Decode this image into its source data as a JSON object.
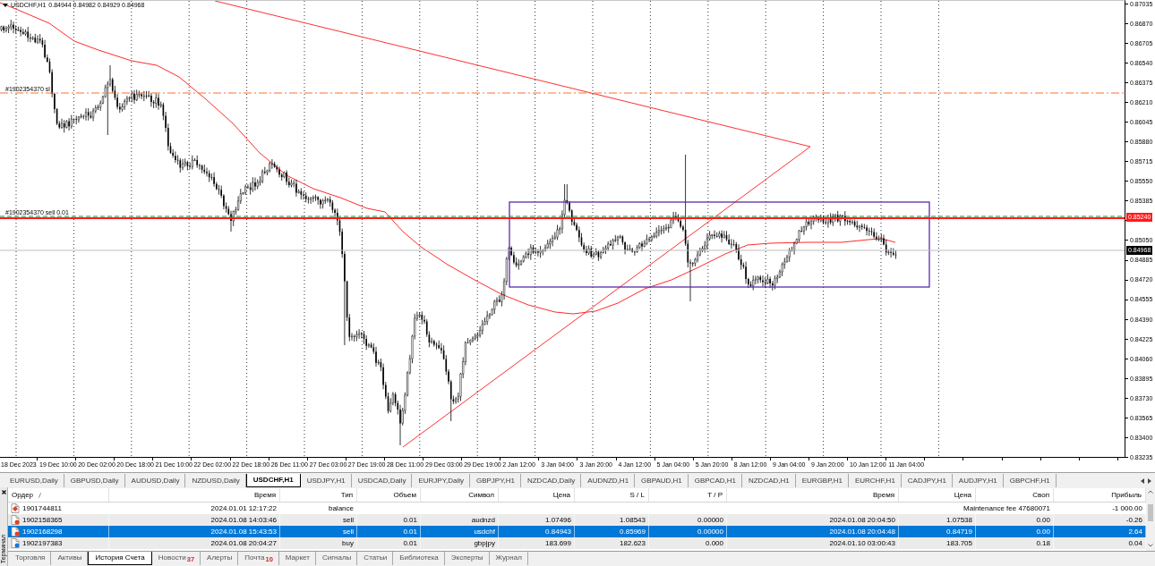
{
  "chart": {
    "symbol": "USDCHF,H1",
    "quotes": "0.84944 0.84982 0.84929 0.84968",
    "order_lines": [
      {
        "kind": "stop_loss",
        "label": "#1902354370 sl"
      },
      {
        "kind": "entry",
        "label": "#1902354370 sell 0.01"
      }
    ],
    "price_tags": [
      {
        "kind": "line",
        "label": "0.85240"
      },
      {
        "kind": "bid",
        "label": "0.84968"
      }
    ],
    "price_axis": [
      "0.87035",
      "0.86870",
      "0.86705",
      "0.86540",
      "0.86375",
      "0.86210",
      "0.86045",
      "0.85880",
      "0.85715",
      "0.85550",
      "0.85385",
      "0.85050",
      "0.84885",
      "0.84720",
      "0.84555",
      "0.84390",
      "0.84225",
      "0.84060",
      "0.83895",
      "0.83730",
      "0.83565",
      "0.83400",
      "0.83235"
    ],
    "time_axis": [
      "18 Dec 2023",
      "19 Dec 10:00",
      "20 Dec 02:00",
      "20 Dec 18:00",
      "21 Dec 10:00",
      "22 Dec 02:00",
      "22 Dec 18:00",
      "26 Dec 11:00",
      "27 Dec 03:00",
      "27 Dec 19:00",
      "28 Dec 11:00",
      "29 Dec 03:00",
      "29 Dec 19:00",
      "2 Jan 12:00",
      "3 Jan 04:00",
      "3 Jan 20:00",
      "4 Jan 12:00",
      "5 Jan 04:00",
      "5 Jan 20:00",
      "8 Jan 12:00",
      "9 Jan 04:00",
      "9 Jan 20:00",
      "10 Jan 12:00",
      "11 Jan 04:00"
    ]
  },
  "symbol_tabs": [
    {
      "label": "EURUSD,Daily",
      "selected": false
    },
    {
      "label": "GBPUSD,Daily",
      "selected": false
    },
    {
      "label": "AUDUSD,Daily",
      "selected": false
    },
    {
      "label": "NZDUSD,Daily",
      "selected": false
    },
    {
      "label": "USDCHF,H1",
      "selected": true
    },
    {
      "label": "USDJPY,H1",
      "selected": false
    },
    {
      "label": "USDCAD,Daily",
      "selected": false
    },
    {
      "label": "EURJPY,Daily",
      "selected": false
    },
    {
      "label": "GBPJPY,H1",
      "selected": false
    },
    {
      "label": "NZDCAD,Daily",
      "selected": false
    },
    {
      "label": "AUDNZD,H1",
      "selected": false
    },
    {
      "label": "GBPAUD,H1",
      "selected": false
    },
    {
      "label": "GBPCAD,H1",
      "selected": false
    },
    {
      "label": "NZDCAD,H1",
      "selected": false
    },
    {
      "label": "EURGBP,H1",
      "selected": false
    },
    {
      "label": "EURCHF,H1",
      "selected": false
    },
    {
      "label": "CADJPY,H1",
      "selected": false
    },
    {
      "label": "AUDJPY,H1",
      "selected": false
    },
    {
      "label": "GBPCHF,H1",
      "selected": false
    }
  ],
  "terminal": {
    "title": "Терминал",
    "columns": [
      {
        "label": "Ордер",
        "sorted": true
      },
      {
        "label": "Время",
        "sorted": false
      },
      {
        "label": "Тип",
        "sorted": false
      },
      {
        "label": "Объем",
        "sorted": false
      },
      {
        "label": "Символ",
        "sorted": false
      },
      {
        "label": "Цена",
        "sorted": false
      },
      {
        "label": "S / L",
        "sorted": false
      },
      {
        "label": "T / P",
        "sorted": false
      },
      {
        "label": "Время",
        "sorted": false
      },
      {
        "label": "Цена",
        "sorted": false
      },
      {
        "label": "Своп",
        "sorted": false
      },
      {
        "label": "Прибыль",
        "sorted": false
      }
    ],
    "rows": [
      {
        "kind": "balance",
        "selected": false,
        "cells": [
          "1901744811",
          "2024.01.01 12:17:22",
          "balance"
        ],
        "comment": "Maintenance fee 47680071",
        "profit": "-1 000.00"
      },
      {
        "kind": "sell",
        "selected": false,
        "cells": [
          "1902158365",
          "2024.01.08 14:03:46",
          "sell",
          "0.01",
          "audnzd",
          "1.07496",
          "1.08543",
          "0.00000",
          "2024.01.08 20:04:50",
          "1.07538",
          "0.00",
          "-0.26"
        ]
      },
      {
        "kind": "sell",
        "selected": true,
        "cells": [
          "1902168298",
          "2024.01.08 15:43:53",
          "sell",
          "0.01",
          "usdchf",
          "0.84943",
          "0.85969",
          "0.00000",
          "2024.01.08 20:04:48",
          "0.84719",
          "0.00",
          "2.64"
        ]
      },
      {
        "kind": "buy",
        "selected": false,
        "cells": [
          "1902197383",
          "2024.01.08 20:04:27",
          "buy",
          "0.01",
          "gbpjpy",
          "183.699",
          "182.623",
          "0.000",
          "2024.01.10 03:00:43",
          "183.705",
          "0.18",
          "0.04"
        ]
      }
    ],
    "tabs": [
      {
        "label": "Торговля",
        "selected": false
      },
      {
        "label": "Активы",
        "selected": false
      },
      {
        "label": "История Счета",
        "selected": true
      },
      {
        "label": "Новости",
        "badge": "37",
        "selected": false
      },
      {
        "label": "Алерты",
        "selected": false
      },
      {
        "label": "Почта",
        "badge": "10",
        "selected": false
      },
      {
        "label": "Маркет",
        "selected": false
      },
      {
        "label": "Сигналы",
        "selected": false
      },
      {
        "label": "Статьи",
        "selected": false
      },
      {
        "label": "Библиотека",
        "selected": false
      },
      {
        "label": "Эксперты",
        "selected": false
      },
      {
        "label": "Журнал",
        "selected": false
      }
    ]
  }
}
